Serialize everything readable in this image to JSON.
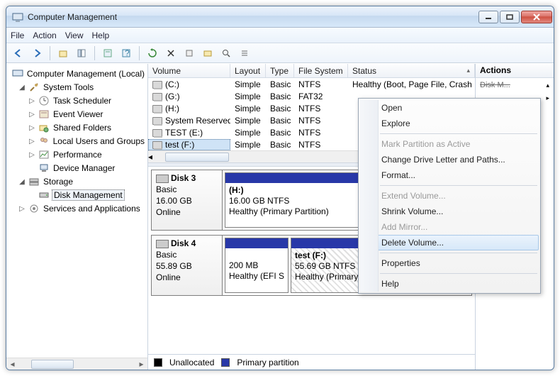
{
  "window": {
    "title": "Computer Management"
  },
  "menu": {
    "file": "File",
    "action": "Action",
    "view": "View",
    "help": "Help"
  },
  "tree": {
    "root": "Computer Management (Local)",
    "system_tools": "System Tools",
    "task_scheduler": "Task Scheduler",
    "event_viewer": "Event Viewer",
    "shared_folders": "Shared Folders",
    "local_users": "Local Users and Groups",
    "performance": "Performance",
    "device_manager": "Device Manager",
    "storage": "Storage",
    "disk_management": "Disk Management",
    "services_apps": "Services and Applications"
  },
  "cols": {
    "volume": "Volume",
    "layout": "Layout",
    "type": "Type",
    "fs": "File System",
    "status": "Status"
  },
  "volumes": [
    {
      "name": "(C:)",
      "layout": "Simple",
      "type": "Basic",
      "fs": "NTFS",
      "status": "Healthy (Boot, Page File, Crash Dump, Primary Partition)"
    },
    {
      "name": "(G:)",
      "layout": "Simple",
      "type": "Basic",
      "fs": "FAT32",
      "status": ""
    },
    {
      "name": "(H:)",
      "layout": "Simple",
      "type": "Basic",
      "fs": "NTFS",
      "status": ""
    },
    {
      "name": "System Reserved",
      "layout": "Simple",
      "type": "Basic",
      "fs": "NTFS",
      "status": ""
    },
    {
      "name": "TEST (E:)",
      "layout": "Simple",
      "type": "Basic",
      "fs": "NTFS",
      "status": ""
    },
    {
      "name": "test (F:)",
      "layout": "Simple",
      "type": "Basic",
      "fs": "NTFS",
      "status": ""
    }
  ],
  "disks": {
    "d3": {
      "title": "Disk 3",
      "type": "Basic",
      "size": "16.00 GB",
      "state": "Online",
      "p1": {
        "label": "(H:)",
        "size": "16.00 GB NTFS",
        "status": "Healthy (Primary Partition)"
      }
    },
    "d4": {
      "title": "Disk 4",
      "type": "Basic",
      "size": "55.89 GB",
      "state": "Online",
      "p1": {
        "size": "200 MB",
        "status": "Healthy (EFI System Partition)"
      },
      "p2": {
        "label": "test  (F:)",
        "size": "55.69 GB NTFS",
        "status": "Healthy (Primary Partition)"
      }
    }
  },
  "legend": {
    "unalloc": "Unallocated",
    "primary": "Primary partition"
  },
  "actions": {
    "header": "Actions",
    "item1": "Disk M..."
  },
  "ctx": {
    "open": "Open",
    "explore": "Explore",
    "mark_active": "Mark Partition as Active",
    "change_letter": "Change Drive Letter and Paths...",
    "format": "Format...",
    "extend": "Extend Volume...",
    "shrink": "Shrink Volume...",
    "add_mirror": "Add Mirror...",
    "delete": "Delete Volume...",
    "properties": "Properties",
    "help": "Help"
  }
}
